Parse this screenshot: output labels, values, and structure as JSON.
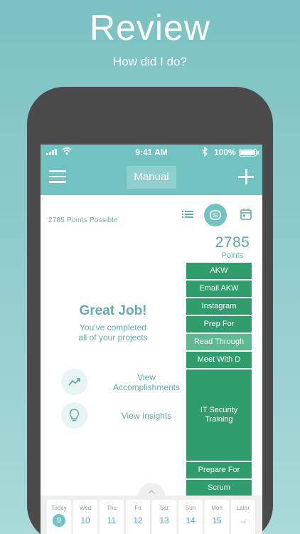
{
  "header": {
    "title": "Review",
    "subtitle": "How did I do?"
  },
  "status_bar": {
    "time": "9:41 AM",
    "battery": "100%"
  },
  "nav": {
    "title": "Manual"
  },
  "summary": {
    "points_possible": "2785 Points Possible",
    "total_points": "2785",
    "points_label": "Points"
  },
  "completion": {
    "title": "Great Job!",
    "line1": "You've completed",
    "line2": "all of your projects"
  },
  "actions": {
    "accomplishments_line1": "View",
    "accomplishments_line2": "Accomplishments",
    "insights": "View Insights"
  },
  "blocks": [
    {
      "label": "AKW",
      "color": "#2f9d6c"
    },
    {
      "label": "Email AKW",
      "color": "#2f9d6c"
    },
    {
      "label": "Instagram",
      "color": "#2f9d6c"
    },
    {
      "label": "Prep For",
      "color": "#2f9d6c"
    },
    {
      "label": "Read Through",
      "color": "#5fb98e"
    },
    {
      "label": "Meet With D",
      "color": "#2f9d6c"
    },
    {
      "label": "IT Security Training",
      "color": "#2f9d6c"
    },
    {
      "label": "Prepare For",
      "color": "#2f9d6c"
    },
    {
      "label": "Scrum",
      "color": "#2f9d6c"
    }
  ],
  "days": [
    {
      "name": "Today",
      "num": "9"
    },
    {
      "name": "Wed",
      "num": "10"
    },
    {
      "name": "Thu",
      "num": "11"
    },
    {
      "name": "Fri",
      "num": "12"
    },
    {
      "name": "Sat",
      "num": "13"
    },
    {
      "name": "Sun",
      "num": "14"
    },
    {
      "name": "Mon",
      "num": "15"
    },
    {
      "name": "Later",
      "num": "→"
    }
  ],
  "colors": {
    "accent": "#70c3c1",
    "block_green": "#2f9d6c",
    "phone_frame": "#4b4b4b"
  }
}
